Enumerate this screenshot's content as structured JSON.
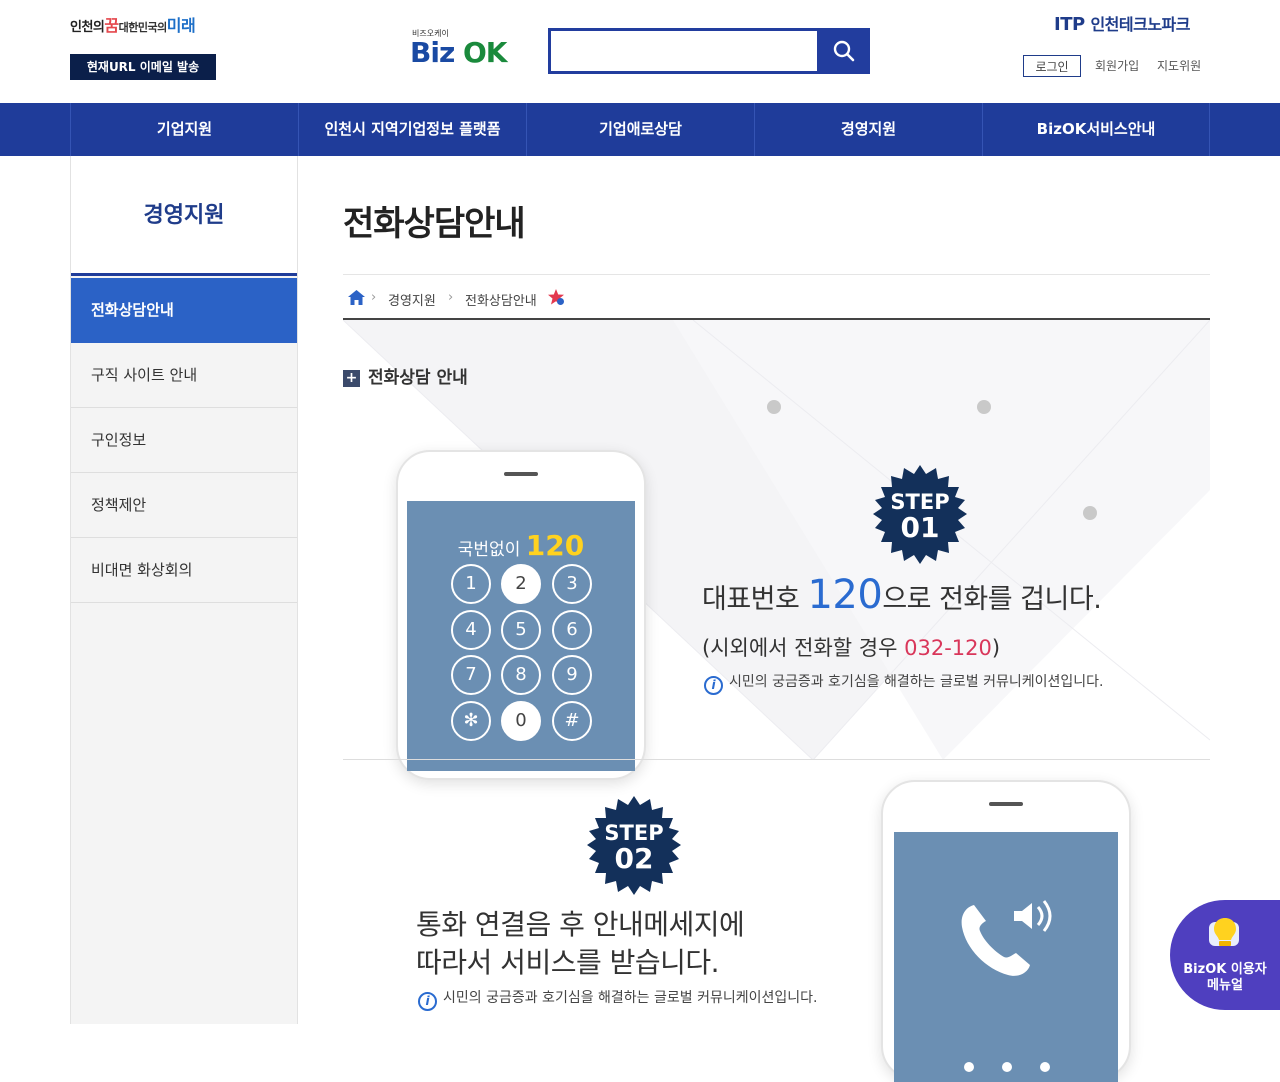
{
  "header": {
    "slogan": {
      "p1": "인천의",
      "p2": "꿈",
      "p3": "대한민국의",
      "p4": "미래"
    },
    "mail_button": "현재URL 이메일 발송",
    "logo": {
      "sub": "비즈오케이",
      "biz": "Biz",
      "ok": "OK"
    },
    "search": {
      "value": "",
      "placeholder": ""
    },
    "itp": {
      "brand": "ITP",
      "name": "인천테크노파크"
    },
    "util": {
      "login": "로그인",
      "join": "회원가입",
      "sitemap": "지도위원"
    }
  },
  "gnb": [
    "기업지원",
    "인천시 지역기업정보 플랫폼",
    "기업애로상담",
    "경영지원",
    "BizOK서비스안내"
  ],
  "lnb": {
    "title": "경영지원",
    "items": [
      "전화상담안내",
      "구직 사이트 안내",
      "구인정보",
      "정책제안",
      "비대면 화상회의"
    ]
  },
  "page": {
    "title": "전화상담안내",
    "breadcrumb": [
      "경영지원",
      "전화상담안내"
    ],
    "section_title": "전화상담 안내"
  },
  "step1": {
    "step_label": "STEP",
    "step_num": "01",
    "dial_prefix": "국번없이",
    "dial_number": "120",
    "keys": [
      "1",
      "2",
      "3",
      "4",
      "5",
      "6",
      "7",
      "8",
      "9",
      "✻",
      "0",
      "#"
    ],
    "line1_pre": "대표번호 ",
    "line1_num": "120",
    "line1_post": "으로 전화를 겁니다.",
    "line2_pre": "(시외에서 전화할 경우 ",
    "line2_num": "032-120",
    "line2_post": ")",
    "info": "시민의 궁금증과 호기심을 해결하는 글로벌 커뮤니케이션입니다."
  },
  "step2": {
    "step_label": "STEP",
    "step_num": "02",
    "line1": "통화 연결음 후 안내메세지에",
    "line2": "따라서 서비스를 받습니다.",
    "info": "시민의 궁금증과 호기심을 해결하는 글로벌 커뮤니케이션입니다."
  },
  "float_menu": {
    "line1": "BizOK 이용자",
    "line2": "메뉴얼"
  },
  "colors": {
    "primary": "#1f3c9a",
    "active": "#2b62c6",
    "accent_red": "#d9365a",
    "accent_yellow": "#ffd21f"
  }
}
